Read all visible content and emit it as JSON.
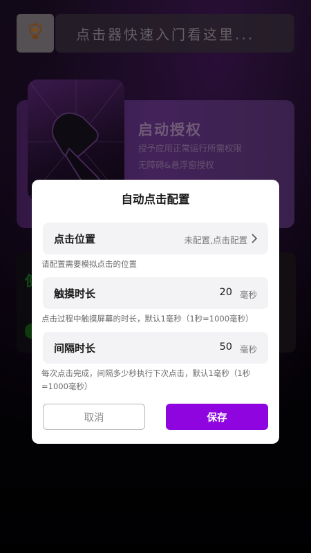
{
  "header": {
    "search_placeholder": "点击器快速入门看这里..."
  },
  "auth_card": {
    "title": "启动授权",
    "subtitle1": "授予应用正常运行所需权限",
    "subtitle2": "无障碍&悬浮窗授权"
  },
  "background": {
    "partial_glyph": "使"
  },
  "dialog": {
    "title": "自动点击配置",
    "click_position": {
      "label": "点击位置",
      "value": "未配置,点击配置"
    },
    "click_position_hint": "请配置需要模拟点击的位置",
    "touch_duration": {
      "label": "触摸时长",
      "value": "20",
      "unit": "毫秒"
    },
    "touch_duration_hint": "点击过程中触摸屏幕的时长，默认1毫秒（1秒=1000毫秒）",
    "interval": {
      "label": "间隔时长",
      "value": "50",
      "unit": "毫秒"
    },
    "interval_hint": "每次点击完成，间隔多少秒执行下次点击，默认1毫秒（1秒=1000毫秒）",
    "cancel_label": "取消",
    "save_label": "保存"
  },
  "colors": {
    "accent": "#8e05e0",
    "dialog_bg": "#ffffff",
    "row_bg": "#f3f3f5"
  }
}
